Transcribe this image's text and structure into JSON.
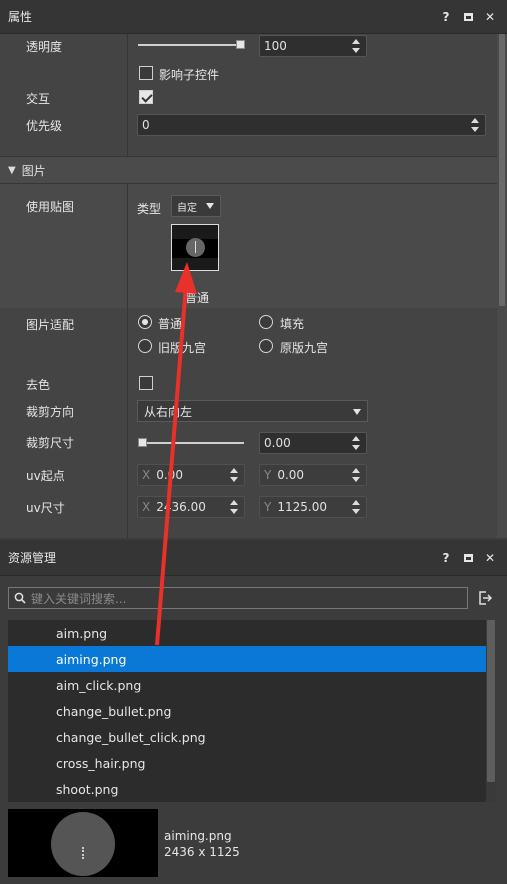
{
  "properties_panel": {
    "title": "属性",
    "header_buttons": [
      "?",
      "□",
      "✕"
    ],
    "opacity": {
      "label": "透明度",
      "value": "100",
      "level_percent": 100
    },
    "affect_children": {
      "label": "影响子控件",
      "checked": false
    },
    "interaction": {
      "label": "交互",
      "checked": true
    },
    "priority": {
      "label": "优先级",
      "value": "0"
    },
    "image_section": {
      "title": "图片",
      "use_texture": {
        "label": "使用贴图",
        "type_label": "类型",
        "type_value": "自定",
        "thumb_caption": "普通"
      },
      "image_fit": {
        "label": "图片适配",
        "options": [
          "普通",
          "填充",
          "旧版九宫",
          "原版九宫"
        ],
        "selected": "普通"
      },
      "desaturate": {
        "label": "去色",
        "checked": false
      },
      "clip_direction": {
        "label": "裁剪方向",
        "value": "从右向左"
      },
      "clip_size": {
        "label": "裁剪尺寸",
        "value": "0.00",
        "level_percent": 0
      },
      "uv_origin": {
        "label": "uv起点",
        "x_prefix": "X",
        "x": "0.00",
        "y_prefix": "Y",
        "y": "0.00"
      },
      "uv_size": {
        "label": "uv尺寸",
        "x_prefix": "X",
        "x": "2436.00",
        "y_prefix": "Y",
        "y": "1125.00"
      }
    }
  },
  "assets_panel": {
    "title": "资源管理",
    "header_buttons": [
      "?",
      "□",
      "✕"
    ],
    "search_placeholder": "键入关键词搜索...",
    "files": [
      "aim.png",
      "aiming.png",
      "aim_click.png",
      "change_bullet.png",
      "change_bullet_click.png",
      "cross_hair.png",
      "shoot.png"
    ],
    "selected_file": "aiming.png",
    "preview": {
      "name": "aiming.png",
      "dimensions": "2436 x 1125"
    }
  },
  "colors": {
    "selection": "#0a78d7",
    "annotation_arrow": "#e8312a"
  }
}
